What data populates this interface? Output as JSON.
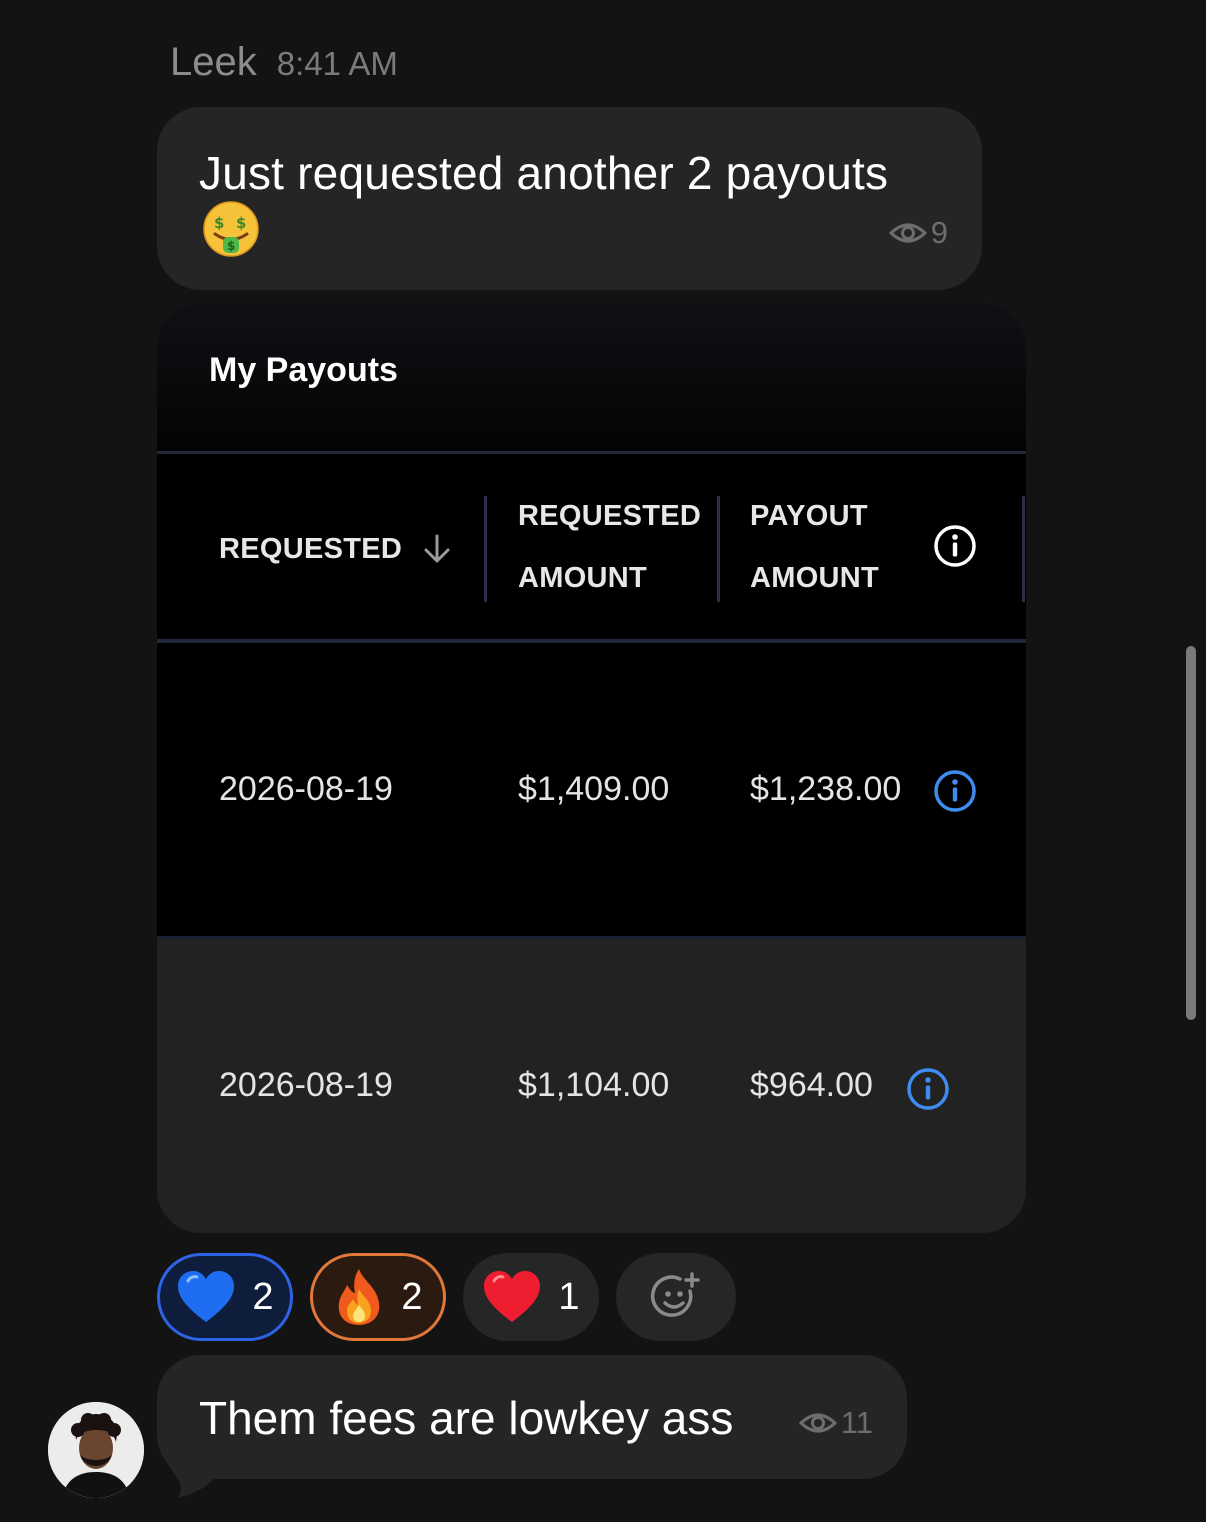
{
  "message1": {
    "sender": "Leek",
    "time": "8:41 AM",
    "text": "Just requested another 2 payouts",
    "emoji": "money-mouth-face",
    "views": "9"
  },
  "payout_card": {
    "title": "My Payouts",
    "columns": {
      "requested": "REQUESTED",
      "requested_amount_1": "REQUESTED",
      "requested_amount_2": "AMOUNT",
      "payout_amount_1": "PAYOUT",
      "payout_amount_2": "AMOUNT"
    },
    "sort_icon": "arrow-down-icon",
    "rows": [
      {
        "requested": "2026-08-19",
        "requested_amount": "$1,409.00",
        "payout_amount": "$1,238.00"
      },
      {
        "requested": "2026-08-19",
        "requested_amount": "$1,104.00",
        "payout_amount": "$964.00"
      }
    ],
    "colors": {
      "accent_info": "#3f8bf0",
      "header_bg": "#000000",
      "divider": "#23253a"
    }
  },
  "reactions": [
    {
      "emoji": "blue-heart",
      "count": "2",
      "selected": true,
      "color": "#2f63e6"
    },
    {
      "emoji": "fire",
      "count": "2",
      "selected": true,
      "color": "#e1783a"
    },
    {
      "emoji": "red-heart",
      "count": "1",
      "selected": false
    },
    {
      "emoji": "add-reaction-icon",
      "count": ""
    }
  ],
  "message2": {
    "text": "Them fees are lowkey ass",
    "views": "11"
  }
}
